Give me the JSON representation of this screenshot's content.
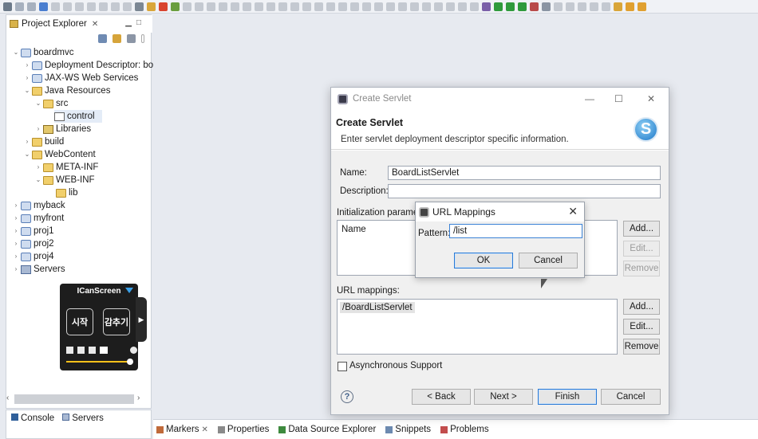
{
  "project_explorer": {
    "tab_label": "Project Explorer",
    "tree": [
      {
        "label": "boardmvc",
        "icon": "project-icon",
        "expanded": true
      },
      {
        "label": "Deployment Descriptor: bo",
        "icon": "deployment-descriptor-icon"
      },
      {
        "label": "JAX-WS Web Services",
        "icon": "web-services-icon"
      },
      {
        "label": "Java Resources",
        "icon": "java-resources-icon",
        "expanded": true
      },
      {
        "label": "src",
        "icon": "source-folder-icon",
        "expanded": true
      },
      {
        "label": "control",
        "icon": "package-icon"
      },
      {
        "label": "Libraries",
        "icon": "libraries-icon"
      },
      {
        "label": "build",
        "icon": "folder-icon"
      },
      {
        "label": "WebContent",
        "icon": "folder-icon",
        "expanded": true
      },
      {
        "label": "META-INF",
        "icon": "folder-icon"
      },
      {
        "label": "WEB-INF",
        "icon": "folder-icon",
        "expanded": true
      },
      {
        "label": "lib",
        "icon": "folder-icon"
      },
      {
        "label": "myback",
        "icon": "project-icon"
      },
      {
        "label": "myfront",
        "icon": "project-icon"
      },
      {
        "label": "proj1",
        "icon": "project-icon"
      },
      {
        "label": "proj2",
        "icon": "project-icon"
      },
      {
        "label": "proj4",
        "icon": "project-icon"
      },
      {
        "label": "Servers",
        "icon": "servers-icon"
      }
    ]
  },
  "bottom_left_tabs": {
    "console": "Console",
    "servers": "Servers"
  },
  "lower_tabs": [
    "Markers",
    "Properties",
    "Data Source Explorer",
    "Snippets",
    "Problems"
  ],
  "icanscreen": {
    "title": "ICanScreen",
    "start": "시작",
    "hide": "감추기"
  },
  "create_servlet": {
    "window_title": "Create Servlet",
    "heading": "Create Servlet",
    "subtitle": "Enter servlet deployment descriptor specific information.",
    "name_label": "Name:",
    "name_value": "BoardListServlet",
    "description_label": "Description:",
    "description_value": "",
    "init_params_label": "Initialization parame",
    "init_col_name": "Name",
    "init_buttons": [
      "Add...",
      "Edit...",
      "Remove"
    ],
    "url_mappings_label": "URL mappings:",
    "url_mappings": [
      "/BoardListServlet"
    ],
    "url_buttons": [
      "Add...",
      "Edit...",
      "Remove"
    ],
    "async_label": "Asynchronous Support",
    "back": "< Back",
    "next": "Next >",
    "finish": "Finish",
    "cancel": "Cancel"
  },
  "url_dialog": {
    "title": "URL Mappings",
    "pattern_label": "Pattern:",
    "pattern_value": "/list",
    "ok": "OK",
    "cancel": "Cancel"
  },
  "colors": {
    "accent": "#2a7ad6",
    "selection": "#cce4f7"
  }
}
